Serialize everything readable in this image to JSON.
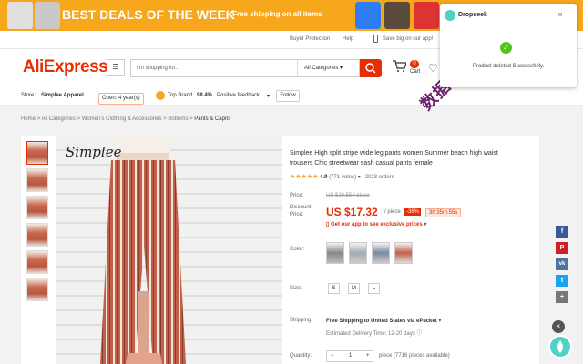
{
  "banner": {
    "title": "BEST DEALS OF THE WEEK",
    "subtitle": "Free shipping on all items"
  },
  "topbar": {
    "buyer_protection": "Buyer Protection",
    "help": "Help",
    "save_app": "Save big on our app!"
  },
  "header": {
    "logo": "AliExpress",
    "search_placeholder": "I'm shopping for...",
    "category_select": "All Categories",
    "cart_count": "0",
    "cart_label": "Cart"
  },
  "store": {
    "label": "Store:",
    "name": "Simplee Apparel",
    "open": "Open: 4 year(s)",
    "top_brand": "Top Brand",
    "feedback_pct": "98.4%",
    "feedback_label": "Positive feedback",
    "follow": "Follow"
  },
  "breadcrumb": [
    "Home",
    "All Categories",
    "Women's Clothing & Accessories",
    "Bottoms",
    "Pants & Capris"
  ],
  "breadcrumb_separator": ">",
  "product": {
    "brand_watermark": "Simplee",
    "title": "Simplee High split stripe wide leg pants women Summer beach high waist trousers Chic streetwear sash casual pants female",
    "rating": "4.9",
    "votes": "(771 votes)",
    "orders": "2023 orders",
    "price_label": "Price:",
    "old_price": "US $26.55 / piece",
    "discount_label": "Discount Price:",
    "new_price": "US $17.32",
    "per_piece": "/ piece",
    "discount_pct": "-36%",
    "timer": "3h:35m:55s",
    "app_price": "Get our app to see exclusive prices",
    "color_label": "Color:",
    "size_label": "Size:",
    "sizes": [
      "S",
      "M",
      "L"
    ],
    "shipping_label": "Shipping:",
    "shipping_text": "Free Shipping to United States via ePacket",
    "delivery": "Estimated Delivery Time: 12-20 days",
    "quantity_label": "Quantity:",
    "quantity_value": "1",
    "pieces_available": "piece (7716 pieces available)"
  },
  "watermark": "数据tscs66",
  "notification": {
    "app_name": "Dropseek",
    "close": "×",
    "message": "Product deleted Successfully."
  },
  "share_icons": [
    {
      "name": "facebook",
      "glyph": "f",
      "color": "#3b5998"
    },
    {
      "name": "pinterest",
      "glyph": "P",
      "color": "#cb2027"
    },
    {
      "name": "vk",
      "glyph": "vk",
      "color": "#4c75a3"
    },
    {
      "name": "twitter",
      "glyph": "t",
      "color": "#1da1f2"
    },
    {
      "name": "more",
      "glyph": "+",
      "color": "#777"
    }
  ],
  "colors": {
    "accent": "#e62e04",
    "banner": "#f7a71c",
    "dropseek": "#4fd1c5",
    "success": "#52c41a"
  }
}
